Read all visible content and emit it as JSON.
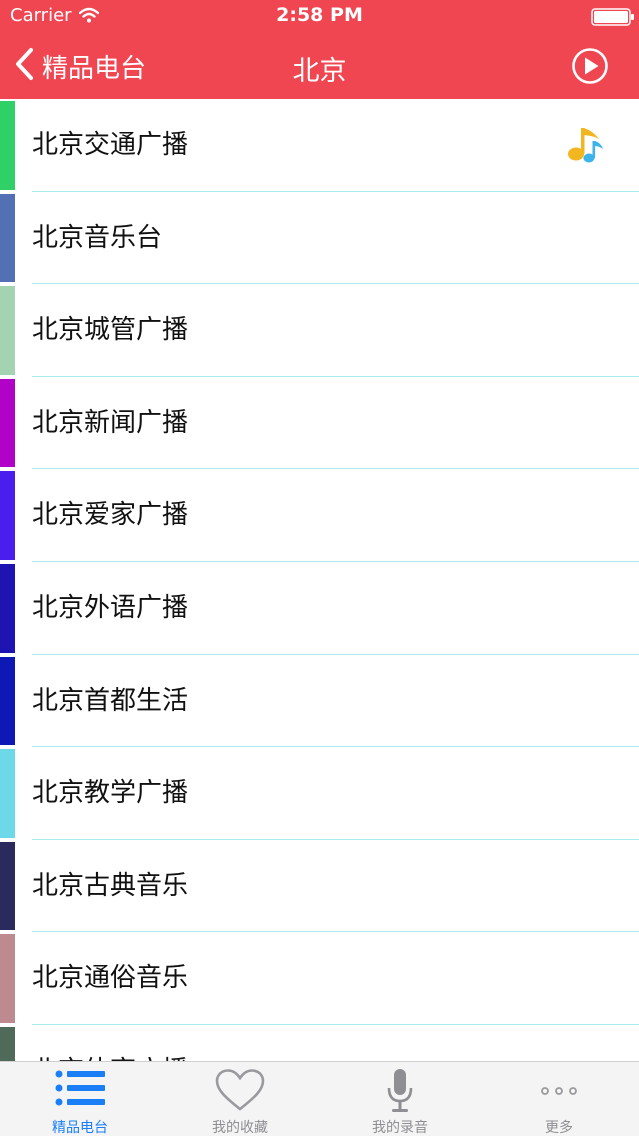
{
  "status_bar": {
    "carrier": "Carrier",
    "time": "2:58 PM"
  },
  "nav": {
    "back_label": "精品电台",
    "title": "北京"
  },
  "stations": [
    {
      "name": "北京交通广播",
      "color": "#2fd065",
      "now_playing": true
    },
    {
      "name": "北京音乐台",
      "color": "#5470b4"
    },
    {
      "name": "北京城管广播",
      "color": "#a3d3b0"
    },
    {
      "name": "北京新闻广播",
      "color": "#b103c7"
    },
    {
      "name": "北京爱家广播",
      "color": "#4a1fee"
    },
    {
      "name": "北京外语广播",
      "color": "#1d14b2"
    },
    {
      "name": "北京首都生活",
      "color": "#0e19b5"
    },
    {
      "name": "北京教学广播",
      "color": "#6dd9e8"
    },
    {
      "name": "北京古典音乐",
      "color": "#2a2a5c"
    },
    {
      "name": "北京通俗音乐",
      "color": "#bd8a8f"
    },
    {
      "name": "北京体育广播",
      "color": "#4f6a59"
    }
  ],
  "tabs": [
    {
      "label": "精品电台",
      "icon": "list-icon",
      "active": true
    },
    {
      "label": "我的收藏",
      "icon": "heart-icon"
    },
    {
      "label": "我的录音",
      "icon": "microphone-icon"
    },
    {
      "label": "更多",
      "icon": "more-icon"
    }
  ],
  "colors": {
    "header": "#ef4652",
    "accent": "#1a7ff7",
    "divider": "#a6ecee",
    "tab_inactive": "#8e8e93"
  }
}
